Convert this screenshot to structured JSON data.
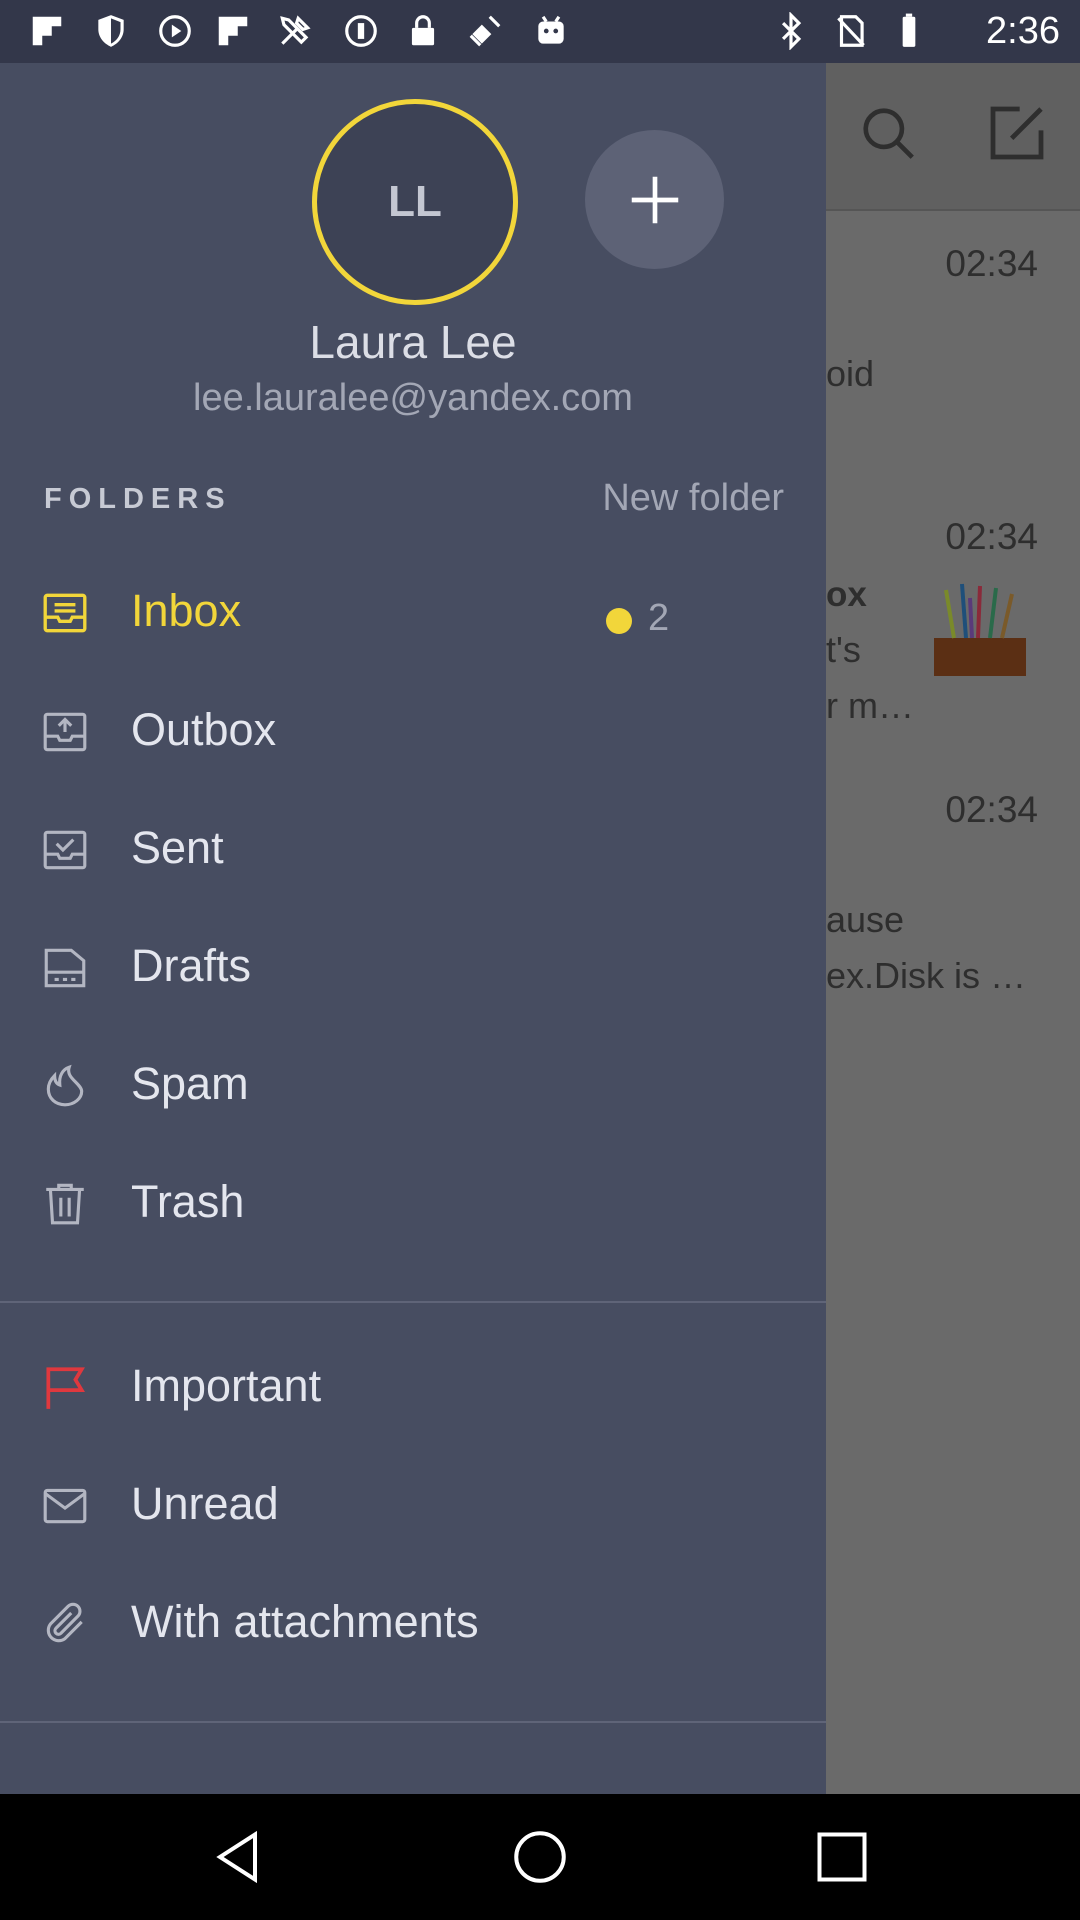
{
  "status_bar": {
    "time": "2:36",
    "icons": [
      "flipboard-icon",
      "shield-icon",
      "play-icon",
      "flipboard-icon",
      "tools-icon",
      "info-circle-icon",
      "lock-icon",
      "fake-gps-satellite-icon",
      "android-icon",
      "bluetooth-icon",
      "no-sim-icon",
      "battery-icon"
    ]
  },
  "background": {
    "times": [
      "02:34",
      "02:34",
      "02:34"
    ],
    "snippets": [
      "oid",
      "ox",
      "t's",
      "r m…",
      "ause",
      "ex.Disk is …"
    ]
  },
  "account": {
    "initials": "LL",
    "name": "Laura Lee",
    "email": "lee.lauralee@yandex.com"
  },
  "folders": {
    "heading": "FOLDERS",
    "new_folder_label": "New folder",
    "items": [
      {
        "label": "Inbox",
        "icon": "inbox-icon",
        "count": "2",
        "active": true
      },
      {
        "label": "Outbox",
        "icon": "outbox-icon"
      },
      {
        "label": "Sent",
        "icon": "sent-icon"
      },
      {
        "label": "Drafts",
        "icon": "drafts-icon"
      },
      {
        "label": "Spam",
        "icon": "spam-flame-icon"
      },
      {
        "label": "Trash",
        "icon": "trash-icon"
      }
    ]
  },
  "filters": {
    "items": [
      {
        "label": "Important",
        "icon": "flag-icon"
      },
      {
        "label": "Unread",
        "icon": "envelope-icon"
      },
      {
        "label": "With attachments",
        "icon": "paperclip-icon"
      }
    ]
  },
  "colors": {
    "accent": "#f2d63a",
    "drawer_bg": "#474d61",
    "important_flag": "#e0383e"
  }
}
